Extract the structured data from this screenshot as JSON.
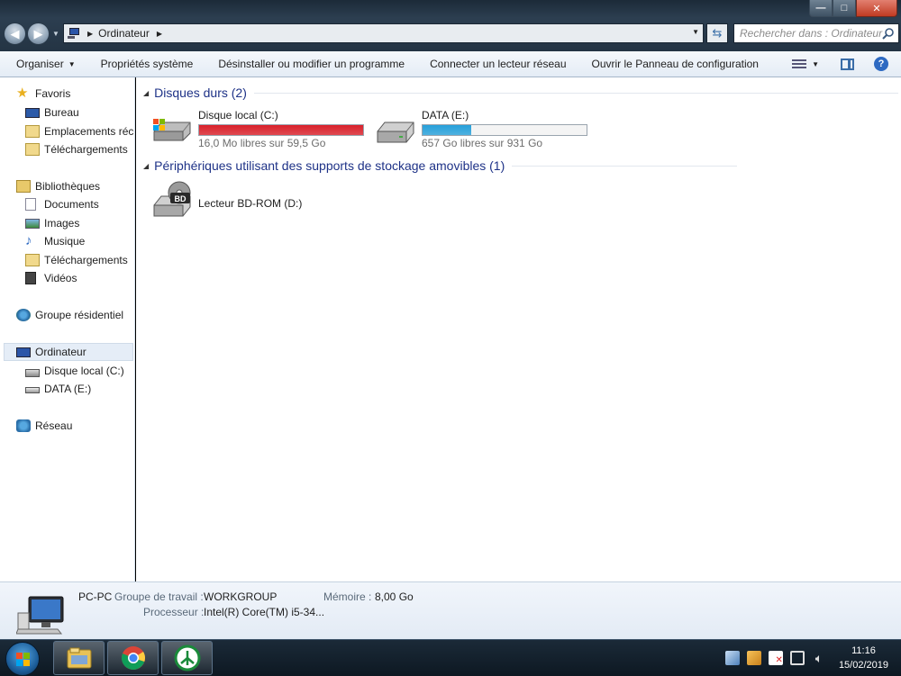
{
  "window": {
    "address": {
      "crumb": "Ordinateur"
    },
    "search": {
      "placeholder": "Rechercher dans : Ordinateur"
    },
    "controls": {
      "minimize": "—",
      "maximize": "□",
      "close": "✕"
    }
  },
  "toolbar": {
    "organize": "Organiser",
    "system_properties": "Propriétés système",
    "uninstall": "Désinstaller ou modifier un programme",
    "map_drive": "Connecter un lecteur réseau",
    "control_panel": "Ouvrir le Panneau de configuration",
    "help": "?"
  },
  "nav": {
    "favorites": {
      "label": "Favoris",
      "items": [
        "Bureau",
        "Emplacements récents",
        "Téléchargements"
      ]
    },
    "libraries": {
      "label": "Bibliothèques",
      "items": [
        "Documents",
        "Images",
        "Musique",
        "Téléchargements",
        "Vidéos"
      ]
    },
    "homegroup": "Groupe résidentiel",
    "computer": {
      "label": "Ordinateur",
      "items": [
        "Disque local (C:)",
        "DATA (E:)"
      ]
    },
    "network": "Réseau"
  },
  "content": {
    "hard_drives": {
      "header": "Disques durs (2)",
      "drives": [
        {
          "name": "Disque local (C:)",
          "info": "16,0 Mo libres sur 59,5 Go",
          "used_fraction": 0.9997,
          "bar_color": "#d9202a"
        },
        {
          "name": "DATA (E:)",
          "info": "657 Go libres sur 931 Go",
          "used_fraction": 0.294,
          "bar_color": "#26a0da"
        }
      ]
    },
    "removable": {
      "header": "Périphériques utilisant des supports de stockage amovibles (1)",
      "devices": [
        {
          "name": "Lecteur BD-ROM (D:)",
          "badge": "BD"
        }
      ]
    }
  },
  "details": {
    "pc_name": "PC-PC",
    "workgroup_label": "Groupe de travail :",
    "workgroup_value": "WORKGROUP",
    "memory_label": "Mémoire :",
    "memory_value": "8,00 Go",
    "processor_label": "Processeur :",
    "processor_value": "Intel(R) Core(TM) i5-34..."
  },
  "taskbar": {
    "apps": [
      "explorer-icon",
      "chrome-icon",
      "tree-app-icon"
    ],
    "time": "11:16",
    "date": "15/02/2019"
  }
}
